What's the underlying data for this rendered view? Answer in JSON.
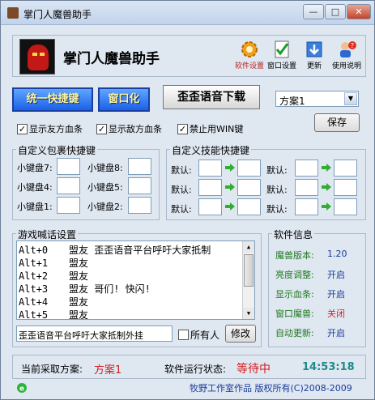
{
  "window": {
    "title": "掌门人魔兽助手",
    "minimize": "—",
    "maximize": "□",
    "close": "✕"
  },
  "header": {
    "app_title": "掌门人魔兽助手",
    "tools": [
      {
        "label": "软件设置",
        "icon": "gear-icon",
        "color": "#c02020"
      },
      {
        "label": "窗口设置",
        "icon": "checklist-icon",
        "color": "#000000"
      },
      {
        "label": "更新",
        "icon": "download-icon",
        "color": "#000000"
      },
      {
        "label": "使用说明",
        "icon": "help-user-icon",
        "color": "#000000"
      }
    ]
  },
  "buttons": {
    "unify_hotkey": "统一快捷键",
    "windowed": "窗口化",
    "voice_download": "歪歪语音下载",
    "save": "保存",
    "modify": "修改"
  },
  "scheme_select": {
    "value": "方案1"
  },
  "checkboxes": [
    {
      "label": "显示友方血条",
      "checked": true
    },
    {
      "label": "显示敌方血条",
      "checked": true
    },
    {
      "label": "禁止用WIN键",
      "checked": true
    }
  ],
  "item_hotkeys": {
    "title": "自定义包裹快捷键",
    "labels": [
      "小键盘7:",
      "小键盘8:",
      "小键盘4:",
      "小键盘5:",
      "小键盘1:",
      "小键盘2:"
    ]
  },
  "skill_hotkeys": {
    "title": "自定义技能快捷键",
    "label": "默认:"
  },
  "shout": {
    "title": "游戏喊话设置",
    "lines": [
      {
        "key": "Alt+0",
        "text": "盟友 歪歪语音平台呼吁大家抵制"
      },
      {
        "key": "Alt+1",
        "text": "盟友"
      },
      {
        "key": "Alt+2",
        "text": "盟友"
      },
      {
        "key": "Alt+3",
        "text": "盟友 哥们! 快闪!"
      },
      {
        "key": "Alt+4",
        "text": "盟友"
      },
      {
        "key": "Alt+5",
        "text": "盟友"
      }
    ],
    "input_value": "歪歪语音平台呼吁大家抵制外挂",
    "all_label": "所有人"
  },
  "info": {
    "title": "软件信息",
    "rows": [
      {
        "label": "魔兽版本:",
        "value": "1.20",
        "color": "#1a3a9a"
      },
      {
        "label": "亮度调整:",
        "value": "开启",
        "color": "#1a3a9a"
      },
      {
        "label": "显示血条:",
        "value": "开启",
        "color": "#1a3a9a"
      },
      {
        "label": "窗口魔兽:",
        "value": "关闭",
        "color": "#d02020"
      },
      {
        "label": "自动更新:",
        "value": "开启",
        "color": "#1a3a9a"
      }
    ]
  },
  "status": {
    "scheme_label": "当前采取方案:",
    "scheme_value": "方案1",
    "state_label": "软件运行状态:",
    "state_value": "等待中",
    "clock": "14:53:18"
  },
  "footer": {
    "text": "牧野工作室作品 版权所有(C)2008-2009"
  }
}
